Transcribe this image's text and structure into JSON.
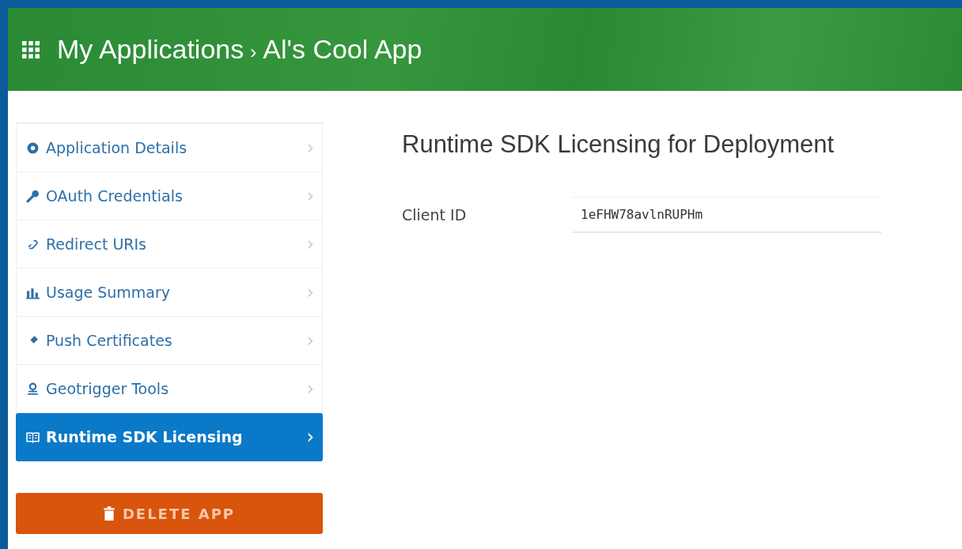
{
  "header": {
    "breadcrumb": [
      "My Applications",
      "Al's Cool App"
    ],
    "separator": "›"
  },
  "sidebar": {
    "items": [
      {
        "label": "Application Details",
        "selected": false
      },
      {
        "label": "OAuth Credentials",
        "selected": false
      },
      {
        "label": "Redirect URIs",
        "selected": false
      },
      {
        "label": "Usage Summary",
        "selected": false
      },
      {
        "label": "Push Certificates",
        "selected": false
      },
      {
        "label": "Geotrigger Tools",
        "selected": false
      },
      {
        "label": "Runtime SDK Licensing",
        "selected": true
      }
    ],
    "chevron": "›",
    "delete_button": "DELETE APP"
  },
  "main": {
    "title": "Runtime SDK Licensing for Deployment",
    "fields": [
      {
        "label": "Client ID",
        "value": "1eFHW78avlnRUPHm"
      }
    ]
  }
}
